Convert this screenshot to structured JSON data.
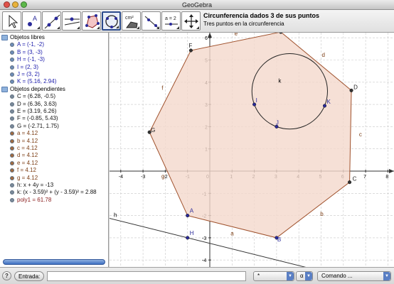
{
  "window": {
    "title": "GeoGebra"
  },
  "toolbar": {
    "tools": [
      {
        "icon": "arrow-move-icon",
        "label": ""
      },
      {
        "icon": "new-point-icon",
        "label": "A"
      },
      {
        "icon": "line-two-points-icon",
        "label": ""
      },
      {
        "icon": "perpendicular-line-icon",
        "label": ""
      },
      {
        "icon": "polygon-icon",
        "label": ""
      },
      {
        "icon": "circle-three-points-icon",
        "label": ""
      },
      {
        "icon": "area-icon",
        "label": "cm²"
      },
      {
        "icon": "angle-icon",
        "label": ""
      },
      {
        "icon": "slider-icon",
        "label": "a = 2"
      },
      {
        "icon": "move-graphics-icon",
        "label": ""
      }
    ],
    "selected_tool": "circle-three-points-icon",
    "tool_title": "Circunferencia dados 3 de sus puntos",
    "tool_help": "Tres puntos en la circunferencia"
  },
  "algebra": {
    "free_header": "Objetos libres",
    "free_objects": [
      "A = (-1, -2)",
      "B = (3, -3)",
      "H = (-1, -3)",
      "I = (2, 3)",
      "J = (3, 2)",
      "K = (5.16, 2.94)"
    ],
    "dependent_header": "Objetos dependientes",
    "dependent_objects": [
      {
        "text": "C = (6.28, -0.5)",
        "kind": "dep"
      },
      {
        "text": "D = (6.36, 3.63)",
        "kind": "dep"
      },
      {
        "text": "E = (3.19, 6.26)",
        "kind": "dep"
      },
      {
        "text": "F = (-0.85, 5.43)",
        "kind": "dep"
      },
      {
        "text": "G = (-2.71, 1.75)",
        "kind": "dep"
      },
      {
        "text": "a = 4.12",
        "kind": "seg"
      },
      {
        "text": "b = 4.12",
        "kind": "seg"
      },
      {
        "text": "c = 4.12",
        "kind": "seg"
      },
      {
        "text": "d = 4.12",
        "kind": "seg"
      },
      {
        "text": "e = 4.12",
        "kind": "seg"
      },
      {
        "text": "f = 4.12",
        "kind": "seg"
      },
      {
        "text": "g = 4.12",
        "kind": "seg"
      },
      {
        "text": "h: x + 4y = -13",
        "kind": "dep"
      },
      {
        "text": "k: (x - 3.59)² + (y - 3.59)² = 2.88",
        "kind": "dep"
      },
      {
        "text": "poly1 = 61.78",
        "kind": "poly"
      }
    ]
  },
  "graphics": {
    "x_ticks": [
      "-4",
      "-3",
      "-2",
      "-1",
      "0",
      "1",
      "2",
      "3",
      "4",
      "5",
      "6",
      "7",
      "8"
    ],
    "y_ticks": [
      "6",
      "5",
      "4",
      "3",
      "2",
      "1",
      "-1",
      "-2",
      "-3",
      "-4"
    ],
    "points": [
      {
        "label": "A",
        "x": -1,
        "y": -2
      },
      {
        "label": "B",
        "x": 3,
        "y": -3
      },
      {
        "label": "C",
        "x": 6.28,
        "y": -0.5
      },
      {
        "label": "D",
        "x": 6.36,
        "y": 3.63
      },
      {
        "label": "E",
        "x": 3.19,
        "y": 6.26
      },
      {
        "label": "F",
        "x": -0.85,
        "y": 5.43
      },
      {
        "label": "G",
        "x": -2.71,
        "y": 1.75
      },
      {
        "label": "H",
        "x": -1,
        "y": -3
      },
      {
        "label": "I",
        "x": 2,
        "y": 3
      },
      {
        "label": "J",
        "x": 3,
        "y": 2
      },
      {
        "label": "K",
        "x": 5.16,
        "y": 2.94
      }
    ],
    "segment_labels": [
      "a",
      "b",
      "c",
      "d",
      "e",
      "f",
      "g"
    ],
    "line_label": "h",
    "circle_label": "k",
    "circle": {
      "cx": 3.59,
      "cy": 3.59,
      "r2": 2.88
    },
    "line": {
      "a": 1,
      "b": 4,
      "c": -13
    },
    "colors": {
      "polygon_fill": "#f4d8cc",
      "polygon_stroke": "#a0522d",
      "point_fill": "#2a2a9a",
      "point_black": "#333333",
      "grid": "#c8c8c8",
      "axis": "#333333",
      "segment_label": "#7b3d14"
    }
  },
  "inputbar": {
    "help": "?",
    "label": "Entrada:",
    "value": "",
    "symbol_select": "*",
    "greek_select": "α",
    "command_select": "Comando ..."
  }
}
